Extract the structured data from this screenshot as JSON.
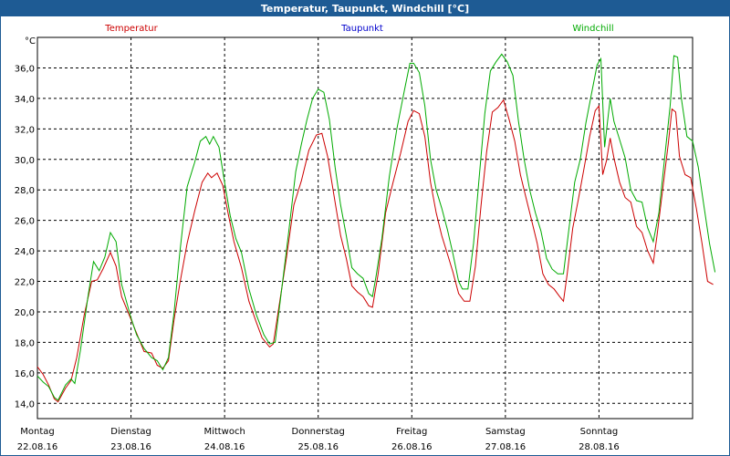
{
  "window": {
    "title": "Temperatur, Taupunkt, Windchill [°C]"
  },
  "chart_data": {
    "type": "line",
    "title": "Temperatur, Taupunkt, Windchill [°C]",
    "ylabel": "°C",
    "ylim": [
      13,
      38
    ],
    "xlim": [
      0,
      7
    ],
    "y_ticks": [
      14.0,
      16.0,
      18.0,
      20.0,
      22.0,
      24.0,
      26.0,
      28.0,
      30.0,
      32.0,
      34.0,
      36.0
    ],
    "y_tick_labels": [
      "14,0",
      "16,0",
      "18,0",
      "20,0",
      "22,0",
      "24,0",
      "26,0",
      "28,0",
      "30,0",
      "32,0",
      "34,0",
      "36,0"
    ],
    "x_ticks": [
      {
        "day": "Montag",
        "date": "22.08.16"
      },
      {
        "day": "Dienstag",
        "date": "23.08.16"
      },
      {
        "day": "Mittwoch",
        "date": "24.08.16"
      },
      {
        "day": "Donnerstag",
        "date": "25.08.16"
      },
      {
        "day": "Freitag",
        "date": "26.08.16"
      },
      {
        "day": "Samstag",
        "date": "27.08.16"
      },
      {
        "day": "Sonntag",
        "date": "28.08.16"
      }
    ],
    "grid": true,
    "legend_position": "top",
    "series": [
      {
        "name": "Temperatur",
        "color": "#cc0000",
        "points": [
          [
            0.0,
            16.4
          ],
          [
            0.06,
            15.9
          ],
          [
            0.12,
            15.2
          ],
          [
            0.18,
            14.3
          ],
          [
            0.22,
            14.1
          ],
          [
            0.3,
            15.0
          ],
          [
            0.36,
            15.5
          ],
          [
            0.42,
            17.0
          ],
          [
            0.5,
            19.8
          ],
          [
            0.58,
            22.0
          ],
          [
            0.64,
            22.1
          ],
          [
            0.7,
            22.8
          ],
          [
            0.78,
            23.9
          ],
          [
            0.84,
            23.0
          ],
          [
            0.9,
            21.0
          ],
          [
            1.0,
            19.5
          ],
          [
            1.06,
            18.6
          ],
          [
            1.14,
            17.4
          ],
          [
            1.22,
            17.3
          ],
          [
            1.28,
            16.5
          ],
          [
            1.34,
            16.3
          ],
          [
            1.4,
            16.8
          ],
          [
            1.46,
            19.5
          ],
          [
            1.52,
            21.8
          ],
          [
            1.6,
            24.5
          ],
          [
            1.68,
            26.6
          ],
          [
            1.76,
            28.5
          ],
          [
            1.82,
            29.1
          ],
          [
            1.86,
            28.8
          ],
          [
            1.92,
            29.1
          ],
          [
            1.98,
            28.3
          ],
          [
            2.04,
            26.4
          ],
          [
            2.1,
            24.6
          ],
          [
            2.18,
            22.9
          ],
          [
            2.26,
            20.7
          ],
          [
            2.34,
            19.3
          ],
          [
            2.4,
            18.3
          ],
          [
            2.48,
            17.7
          ],
          [
            2.52,
            17.9
          ],
          [
            2.58,
            20.3
          ],
          [
            2.66,
            23.5
          ],
          [
            2.74,
            27.0
          ],
          [
            2.82,
            28.6
          ],
          [
            2.9,
            30.6
          ],
          [
            2.98,
            31.6
          ],
          [
            3.04,
            31.7
          ],
          [
            3.1,
            30.2
          ],
          [
            3.18,
            27.2
          ],
          [
            3.24,
            25.0
          ],
          [
            3.3,
            23.5
          ],
          [
            3.36,
            21.7
          ],
          [
            3.42,
            21.3
          ],
          [
            3.48,
            21.0
          ],
          [
            3.54,
            20.4
          ],
          [
            3.58,
            20.3
          ],
          [
            3.64,
            22.5
          ],
          [
            3.72,
            26.5
          ],
          [
            3.8,
            28.5
          ],
          [
            3.88,
            30.4
          ],
          [
            3.96,
            32.5
          ],
          [
            4.02,
            33.2
          ],
          [
            4.08,
            33.0
          ],
          [
            4.14,
            31.5
          ],
          [
            4.2,
            28.5
          ],
          [
            4.26,
            26.5
          ],
          [
            4.32,
            25.0
          ],
          [
            4.38,
            23.8
          ],
          [
            4.44,
            22.6
          ],
          [
            4.5,
            21.2
          ],
          [
            4.56,
            20.7
          ],
          [
            4.62,
            20.7
          ],
          [
            4.68,
            23.0
          ],
          [
            4.74,
            27.0
          ],
          [
            4.8,
            30.5
          ],
          [
            4.86,
            33.1
          ],
          [
            4.92,
            33.4
          ],
          [
            4.98,
            33.9
          ],
          [
            5.04,
            32.6
          ],
          [
            5.1,
            31.2
          ],
          [
            5.16,
            29.0
          ],
          [
            5.22,
            27.5
          ],
          [
            5.28,
            26.0
          ],
          [
            5.34,
            24.5
          ],
          [
            5.4,
            22.5
          ],
          [
            5.46,
            21.8
          ],
          [
            5.52,
            21.5
          ],
          [
            5.58,
            21.0
          ],
          [
            5.62,
            20.7
          ],
          [
            5.66,
            22.5
          ],
          [
            5.72,
            25.5
          ],
          [
            5.78,
            27.4
          ],
          [
            5.84,
            29.4
          ],
          [
            5.9,
            31.5
          ],
          [
            5.96,
            33.2
          ],
          [
            6.0,
            33.5
          ],
          [
            6.04,
            29.0
          ],
          [
            6.08,
            29.9
          ],
          [
            6.12,
            31.4
          ],
          [
            6.16,
            30.1
          ],
          [
            6.22,
            28.5
          ],
          [
            6.28,
            27.5
          ],
          [
            6.34,
            27.2
          ],
          [
            6.4,
            25.6
          ],
          [
            6.46,
            25.2
          ],
          [
            6.52,
            24.0
          ],
          [
            6.58,
            23.2
          ],
          [
            6.62,
            25.0
          ],
          [
            6.68,
            28.0
          ],
          [
            6.74,
            31.0
          ],
          [
            6.78,
            33.3
          ],
          [
            6.82,
            33.1
          ],
          [
            6.86,
            30.2
          ],
          [
            6.92,
            29.0
          ],
          [
            6.98,
            28.8
          ],
          [
            7.04,
            26.8
          ],
          [
            7.1,
            24.5
          ],
          [
            7.16,
            22.0
          ],
          [
            7.22,
            21.8
          ]
        ]
      },
      {
        "name": "Taupunkt",
        "color": "#0000cc",
        "points": []
      },
      {
        "name": "Windchill",
        "color": "#00aa00",
        "points": [
          [
            0.0,
            15.8
          ],
          [
            0.06,
            15.4
          ],
          [
            0.12,
            15.1
          ],
          [
            0.18,
            14.4
          ],
          [
            0.22,
            14.2
          ],
          [
            0.3,
            15.2
          ],
          [
            0.36,
            15.6
          ],
          [
            0.4,
            15.3
          ],
          [
            0.46,
            17.5
          ],
          [
            0.54,
            21.0
          ],
          [
            0.6,
            23.3
          ],
          [
            0.66,
            22.7
          ],
          [
            0.72,
            23.6
          ],
          [
            0.78,
            25.2
          ],
          [
            0.84,
            24.6
          ],
          [
            0.9,
            21.8
          ],
          [
            1.0,
            19.6
          ],
          [
            1.06,
            18.5
          ],
          [
            1.14,
            17.6
          ],
          [
            1.22,
            17.0
          ],
          [
            1.28,
            16.8
          ],
          [
            1.34,
            16.2
          ],
          [
            1.4,
            17.0
          ],
          [
            1.46,
            20.0
          ],
          [
            1.52,
            23.8
          ],
          [
            1.6,
            28.2
          ],
          [
            1.68,
            29.8
          ],
          [
            1.74,
            31.2
          ],
          [
            1.8,
            31.5
          ],
          [
            1.84,
            31.0
          ],
          [
            1.88,
            31.5
          ],
          [
            1.94,
            30.8
          ],
          [
            2.0,
            28.5
          ],
          [
            2.06,
            26.3
          ],
          [
            2.12,
            24.8
          ],
          [
            2.18,
            23.9
          ],
          [
            2.26,
            21.5
          ],
          [
            2.34,
            19.8
          ],
          [
            2.42,
            18.5
          ],
          [
            2.48,
            17.9
          ],
          [
            2.54,
            18.0
          ],
          [
            2.6,
            21.0
          ],
          [
            2.68,
            25.0
          ],
          [
            2.76,
            29.2
          ],
          [
            2.82,
            31.0
          ],
          [
            2.88,
            32.6
          ],
          [
            2.94,
            34.0
          ],
          [
            3.0,
            34.6
          ],
          [
            3.06,
            34.4
          ],
          [
            3.12,
            32.6
          ],
          [
            3.18,
            29.5
          ],
          [
            3.24,
            27.0
          ],
          [
            3.3,
            25.0
          ],
          [
            3.36,
            22.9
          ],
          [
            3.42,
            22.5
          ],
          [
            3.48,
            22.2
          ],
          [
            3.54,
            21.2
          ],
          [
            3.58,
            21.0
          ],
          [
            3.62,
            22.4
          ],
          [
            3.68,
            24.8
          ],
          [
            3.76,
            28.9
          ],
          [
            3.84,
            32.0
          ],
          [
            3.92,
            34.5
          ],
          [
            3.98,
            36.3
          ],
          [
            4.02,
            36.3
          ],
          [
            4.08,
            35.7
          ],
          [
            4.14,
            33.5
          ],
          [
            4.2,
            30.0
          ],
          [
            4.26,
            28.0
          ],
          [
            4.32,
            26.8
          ],
          [
            4.38,
            25.4
          ],
          [
            4.44,
            23.8
          ],
          [
            4.5,
            22.0
          ],
          [
            4.54,
            21.5
          ],
          [
            4.6,
            21.5
          ],
          [
            4.66,
            24.5
          ],
          [
            4.72,
            28.8
          ],
          [
            4.78,
            33.0
          ],
          [
            4.84,
            35.8
          ],
          [
            4.9,
            36.4
          ],
          [
            4.96,
            36.9
          ],
          [
            5.02,
            36.4
          ],
          [
            5.08,
            35.5
          ],
          [
            5.14,
            32.5
          ],
          [
            5.2,
            30.0
          ],
          [
            5.26,
            28.0
          ],
          [
            5.32,
            26.5
          ],
          [
            5.38,
            25.3
          ],
          [
            5.44,
            23.5
          ],
          [
            5.5,
            22.8
          ],
          [
            5.56,
            22.5
          ],
          [
            5.62,
            22.5
          ],
          [
            5.68,
            25.5
          ],
          [
            5.74,
            28.5
          ],
          [
            5.8,
            30.0
          ],
          [
            5.86,
            32.4
          ],
          [
            5.92,
            34.3
          ],
          [
            5.98,
            36.2
          ],
          [
            6.02,
            36.6
          ],
          [
            6.06,
            30.8
          ],
          [
            6.12,
            34.0
          ],
          [
            6.16,
            32.5
          ],
          [
            6.22,
            31.3
          ],
          [
            6.28,
            30.1
          ],
          [
            6.34,
            28.0
          ],
          [
            6.4,
            27.3
          ],
          [
            6.46,
            27.2
          ],
          [
            6.52,
            25.5
          ],
          [
            6.58,
            24.6
          ],
          [
            6.64,
            26.5
          ],
          [
            6.7,
            30.0
          ],
          [
            6.76,
            33.5
          ],
          [
            6.8,
            36.8
          ],
          [
            6.84,
            36.7
          ],
          [
            6.88,
            34.0
          ],
          [
            6.94,
            31.5
          ],
          [
            7.0,
            31.2
          ],
          [
            7.06,
            29.5
          ],
          [
            7.12,
            27.0
          ],
          [
            7.18,
            24.5
          ],
          [
            7.24,
            22.6
          ]
        ]
      }
    ]
  }
}
